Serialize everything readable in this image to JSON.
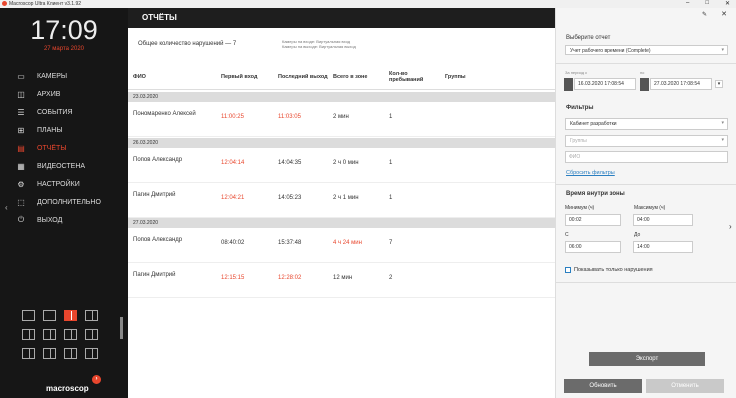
{
  "window": {
    "title": "Macroscop Ultra Клиент v3.1.92",
    "min": "–",
    "max": "□",
    "close": "✕"
  },
  "sidebar": {
    "time": "17:09",
    "date": "27 марта 2020",
    "items": [
      {
        "label": "КАМЕРЫ",
        "icon": "camera-icon"
      },
      {
        "label": "АРХИВ",
        "icon": "archive-icon"
      },
      {
        "label": "СОБЫТИЯ",
        "icon": "events-icon"
      },
      {
        "label": "ПЛАНЫ",
        "icon": "plans-icon"
      },
      {
        "label": "ОТЧЁТЫ",
        "icon": "reports-icon"
      },
      {
        "label": "ВИДЕОСТЕНА",
        "icon": "videowall-icon"
      },
      {
        "label": "НАСТРОЙКИ",
        "icon": "settings-icon"
      },
      {
        "label": "ДОПОЛНИТЕЛЬНО",
        "icon": "extra-icon"
      },
      {
        "label": "ВЫХОД",
        "icon": "exit-icon"
      }
    ],
    "brand": "macroscop",
    "collapse": "‹"
  },
  "main": {
    "title": "ОТЧЁТЫ",
    "summary": "Общее количество нарушений — 7",
    "legend1": "Камеры на входе: Виртуальная вход",
    "legend2": "Камеры на выходе: Виртуальная выход",
    "columns": [
      "ФИО",
      "Первый вход",
      "Последний выход",
      "Всего в зоне",
      "Кол-во пребываний",
      "Группы"
    ],
    "groups": [
      {
        "date": "23.03.2020",
        "rows": [
          {
            "name": "Пономаренко Алексей",
            "first": "11:00:25",
            "last": "11:03:05",
            "total": "2 мин",
            "count": "1"
          }
        ]
      },
      {
        "date": "26.03.2020",
        "rows": [
          {
            "name": "Попов Александр",
            "first": "12:04:14",
            "last": "14:04:35",
            "total": "2 ч 0 мин",
            "count": "1"
          },
          {
            "name": "Пагин Дмитрий",
            "first": "12:04:21",
            "last": "14:05:23",
            "total": "2 ч 1 мин",
            "count": "1"
          }
        ]
      },
      {
        "date": "27.03.2020",
        "rows": [
          {
            "name": "Попов Александр",
            "first": "08:40:02",
            "last": "15:37:48",
            "total": "4 ч 24 мин",
            "count": "7"
          },
          {
            "name": "Пагин Дмитрий",
            "first": "12:15:15",
            "last": "12:28:02",
            "total": "12 мин",
            "count": "2"
          }
        ]
      }
    ]
  },
  "panel": {
    "select_report_label": "Выберите отчет",
    "report_value": "Учет рабочего времени (Complete)",
    "period_from_label": "За период с",
    "period_to_label": "по",
    "date_from": "16.03.2020  17:08:54",
    "date_to": "27.03.2020  17:08:54",
    "filters_label": "Фильтры",
    "filter_camera": "Кабинет разработки",
    "filter_groups_placeholder": "Группы",
    "filter_name_placeholder": "ФИО",
    "reset_filters": "Сбросить фильтры",
    "zone_time_label": "Время внутри зоны",
    "min_label": "Минимум (ч)",
    "max_label": "Максимум (ч)",
    "min_value": "00:02",
    "max_value": "04:00",
    "from_label": "С",
    "to_label": "До",
    "from_value": "06:00",
    "to_value": "14:00",
    "only_violations": "Показывать только нарушения",
    "export": "Экспорт",
    "refresh": "Обновить",
    "cancel": "Отменить"
  }
}
